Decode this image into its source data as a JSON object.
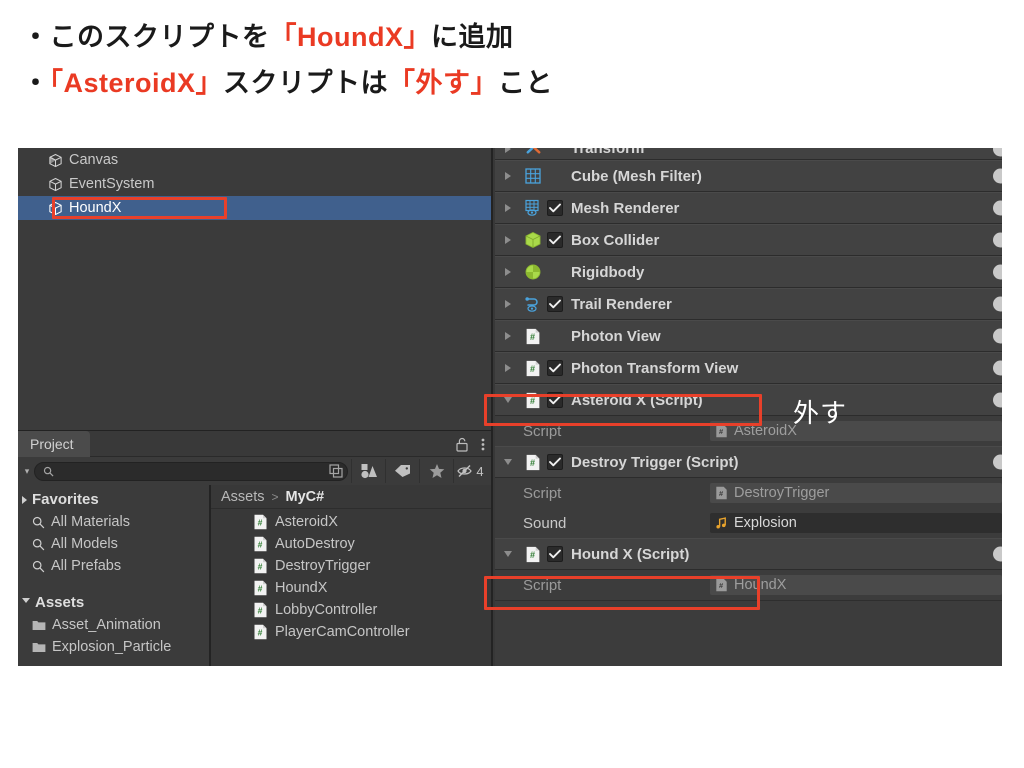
{
  "header": {
    "bullets": [
      {
        "prefix": "・このスクリプトを",
        "highlight": "「HoundX」",
        "suffix": "に追加"
      },
      {
        "prefix": "・",
        "highlight": "「AsteroidX」",
        "mid": "スクリプトは",
        "highlight2": "「外す」",
        "suffix2": "こと"
      }
    ],
    "accent_color": "#ea3a23"
  },
  "hierarchy": {
    "items": [
      {
        "label": "Canvas",
        "icon": "gameobject-icon",
        "expandable": true,
        "selected": false
      },
      {
        "label": "EventSystem",
        "icon": "gameobject-icon",
        "expandable": false,
        "selected": false
      },
      {
        "label": "HoundX",
        "icon": "gameobject-icon",
        "expandable": false,
        "selected": true
      }
    ],
    "selection_color": "#40608d"
  },
  "project": {
    "tab_label": "Project",
    "lock_icon": "lock-open-icon",
    "menu_icon": "kebab-menu-icon",
    "search": {
      "value": "",
      "placeholder": "",
      "icon": "search-icon",
      "expand_icon": "expand-search-icon"
    },
    "toolbar_buttons": [
      {
        "name": "filter-by-type-icon",
        "label": ""
      },
      {
        "name": "filter-by-label-icon",
        "label": ""
      },
      {
        "name": "favorite-star-icon",
        "label": ""
      },
      {
        "name": "hidden-packages-icon",
        "label": "4"
      }
    ],
    "favorites": {
      "title": "Favorites",
      "items": [
        "All Materials",
        "All Models",
        "All Prefabs"
      ]
    },
    "assets_tree": {
      "title": "Assets",
      "items": [
        "Asset_Animation",
        "Explosion_Particle"
      ]
    },
    "breadcrumb": {
      "root": "Assets",
      "separator": ">",
      "current": "MyC#"
    },
    "assets": [
      {
        "name": "AsteroidX",
        "icon": "csharp-script-icon"
      },
      {
        "name": "AutoDestroy",
        "icon": "csharp-script-icon"
      },
      {
        "name": "DestroyTrigger",
        "icon": "csharp-script-icon"
      },
      {
        "name": "HoundX",
        "icon": "csharp-script-icon"
      },
      {
        "name": "LobbyController",
        "icon": "csharp-script-icon"
      },
      {
        "name": "PlayerCamController",
        "icon": "csharp-script-icon"
      }
    ]
  },
  "inspector": {
    "components": [
      {
        "name": "Transform",
        "icon": "transform-icon",
        "expanded": false,
        "has_toggle": false,
        "enabled": false,
        "clipped": true,
        "properties": []
      },
      {
        "name": "Cube (Mesh Filter)",
        "icon": "mesh-filter-icon",
        "expanded": false,
        "has_toggle": false,
        "enabled": false,
        "properties": []
      },
      {
        "name": "Mesh Renderer",
        "icon": "mesh-renderer-icon",
        "expanded": false,
        "has_toggle": true,
        "enabled": true,
        "properties": []
      },
      {
        "name": "Box Collider",
        "icon": "box-collider-icon",
        "expanded": false,
        "has_toggle": true,
        "enabled": true,
        "properties": []
      },
      {
        "name": "Rigidbody",
        "icon": "rigidbody-icon",
        "expanded": false,
        "has_toggle": false,
        "enabled": false,
        "properties": []
      },
      {
        "name": "Trail Renderer",
        "icon": "trail-renderer-icon",
        "expanded": false,
        "has_toggle": true,
        "enabled": true,
        "properties": []
      },
      {
        "name": "Photon View",
        "icon": "csharp-script-icon",
        "expanded": false,
        "has_toggle": false,
        "enabled": false,
        "properties": []
      },
      {
        "name": "Photon Transform View",
        "icon": "csharp-script-icon",
        "expanded": false,
        "has_toggle": true,
        "enabled": true,
        "properties": []
      },
      {
        "name": "Asteroid X (Script)",
        "icon": "csharp-script-icon",
        "expanded": true,
        "has_toggle": true,
        "enabled": true,
        "annotated": true,
        "properties": [
          {
            "label": "Script",
            "value": "AsteroidX",
            "value_icon": "csharp-script-icon",
            "readonly": true
          }
        ]
      },
      {
        "name": "Destroy Trigger (Script)",
        "icon": "csharp-script-icon",
        "expanded": true,
        "has_toggle": true,
        "enabled": true,
        "annotated": false,
        "properties": [
          {
            "label": "Script",
            "value": "DestroyTrigger",
            "value_icon": "csharp-script-icon",
            "readonly": true
          },
          {
            "label": "Sound",
            "value": "Explosion",
            "value_icon": "audio-clip-icon",
            "readonly": false
          }
        ]
      },
      {
        "name": "Hound X (Script)",
        "icon": "csharp-script-icon",
        "expanded": true,
        "has_toggle": true,
        "enabled": true,
        "annotated": true,
        "properties": [
          {
            "label": "Script",
            "value": "HoundX",
            "value_icon": "csharp-script-icon",
            "readonly": true
          }
        ]
      }
    ],
    "help_icon": "help-circle-icon"
  },
  "annotations": {
    "detach_label": "外す",
    "box_color": "#e8402a"
  }
}
